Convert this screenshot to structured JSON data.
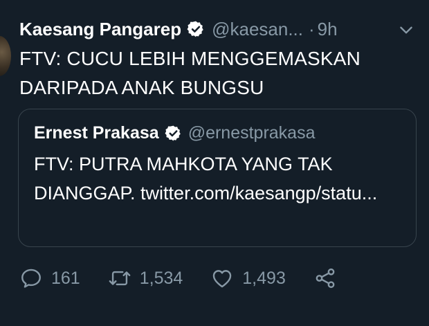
{
  "tweet": {
    "author_name": "Kaesang Pangarep",
    "handle": "@kaesan...",
    "separator": "·",
    "time": "9h",
    "text": "FTV: CUCU LEBIH MENGGEMASKAN DARIPADA ANAK BUNGSU"
  },
  "quoted_tweet": {
    "author_name": "Ernest Prakasa",
    "handle": "@ernestprakasa",
    "text": "FTV: PUTRA MAHKOTA YANG TAK DIANGGAP. twitter.com/kaesangp/statu..."
  },
  "actions": {
    "replies": "161",
    "retweets": "1,534",
    "likes": "1,493"
  },
  "icons": {
    "verified": "verified-badge-icon",
    "menu": "chevron-down-icon",
    "reply": "reply-icon",
    "retweet": "retweet-icon",
    "like": "heart-icon",
    "share": "share-icon"
  },
  "colors": {
    "background": "#141e28",
    "secondary_text": "#8899a6",
    "border": "#38444d"
  }
}
